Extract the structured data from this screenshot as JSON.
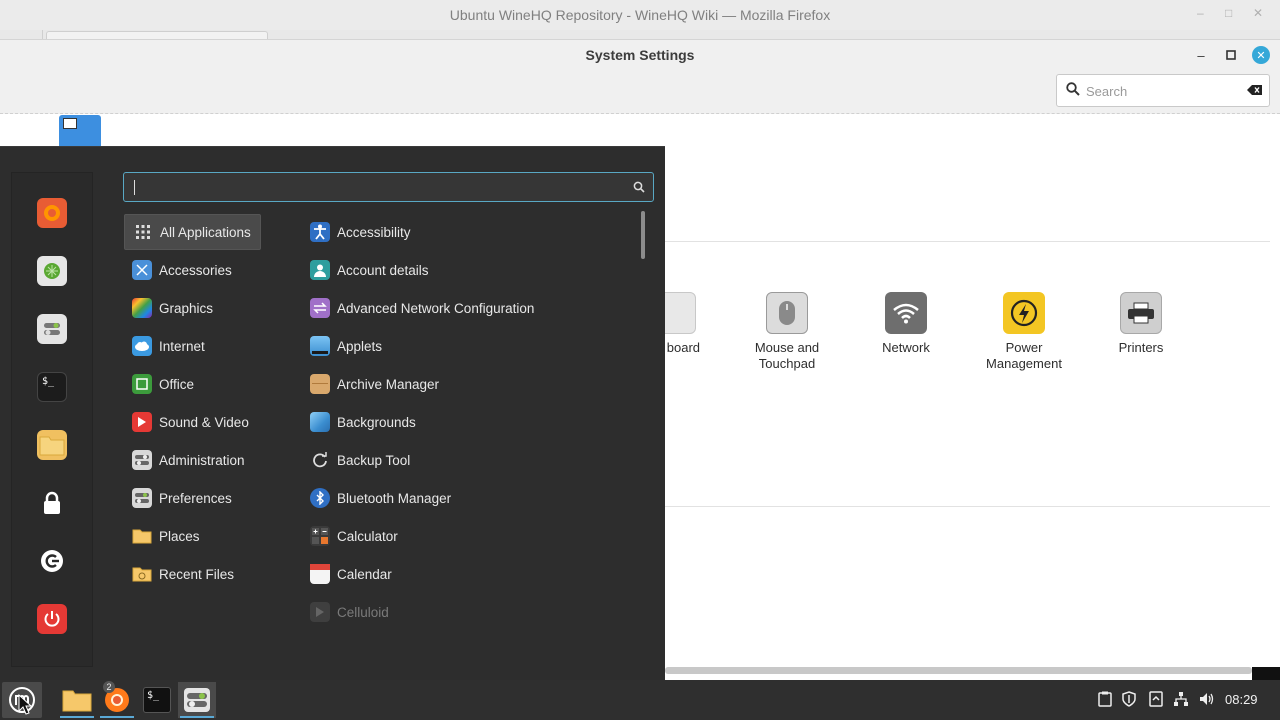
{
  "firefox": {
    "title": "Ubuntu WineHQ Repository - WineHQ Wiki — Mozilla Firefox"
  },
  "settings": {
    "title": "System Settings",
    "search_placeholder": "Search",
    "items": [
      {
        "label": "board",
        "icon": "keyboard-icon"
      },
      {
        "label": "Mouse and Touchpad",
        "icon": "mouse-icon"
      },
      {
        "label": "Network",
        "icon": "wifi-icon"
      },
      {
        "label": "Power Management",
        "icon": "power-bolt-icon"
      },
      {
        "label": "Printers",
        "icon": "printer-icon"
      }
    ]
  },
  "menu": {
    "search_value": "",
    "favorites": [
      {
        "name": "firefox",
        "icon": "firefox-icon"
      },
      {
        "name": "software-manager",
        "icon": "software-manager-icon"
      },
      {
        "name": "system-settings",
        "icon": "settings-toggle-icon"
      },
      {
        "name": "terminal",
        "icon": "terminal-icon"
      },
      {
        "name": "files",
        "icon": "folder-icon"
      },
      {
        "name": "lock-screen",
        "icon": "lock-icon"
      },
      {
        "name": "logout",
        "icon": "logout-icon"
      },
      {
        "name": "shutdown",
        "icon": "power-icon"
      }
    ],
    "categories": [
      {
        "label": "All Applications",
        "icon": "grid-icon",
        "active": true
      },
      {
        "label": "Accessories",
        "icon": "accessories-icon"
      },
      {
        "label": "Graphics",
        "icon": "graphics-icon"
      },
      {
        "label": "Internet",
        "icon": "cloud-icon"
      },
      {
        "label": "Office",
        "icon": "office-icon"
      },
      {
        "label": "Sound & Video",
        "icon": "play-icon"
      },
      {
        "label": "Administration",
        "icon": "administration-icon"
      },
      {
        "label": "Preferences",
        "icon": "preferences-icon"
      },
      {
        "label": "Places",
        "icon": "folder-icon"
      },
      {
        "label": "Recent Files",
        "icon": "recent-files-icon"
      }
    ],
    "apps": [
      {
        "label": "Accessibility",
        "icon": "accessibility-icon"
      },
      {
        "label": "Account details",
        "icon": "account-icon"
      },
      {
        "label": "Advanced Network Configuration",
        "icon": "network-config-icon"
      },
      {
        "label": "Applets",
        "icon": "applets-icon"
      },
      {
        "label": "Archive Manager",
        "icon": "archive-icon"
      },
      {
        "label": "Backgrounds",
        "icon": "backgrounds-icon"
      },
      {
        "label": "Backup Tool",
        "icon": "backup-icon"
      },
      {
        "label": "Bluetooth Manager",
        "icon": "bluetooth-icon"
      },
      {
        "label": "Calculator",
        "icon": "calculator-icon"
      },
      {
        "label": "Calendar",
        "icon": "calendar-icon"
      },
      {
        "label": "Celluloid",
        "icon": "celluloid-icon"
      }
    ]
  },
  "taskbar": {
    "firefox_badge": "2",
    "clock": "08:29"
  },
  "colors": {
    "accent": "#35a8d8",
    "menu_bg": "#2d2d2d",
    "taskbar_bg": "#2f2f2f"
  }
}
